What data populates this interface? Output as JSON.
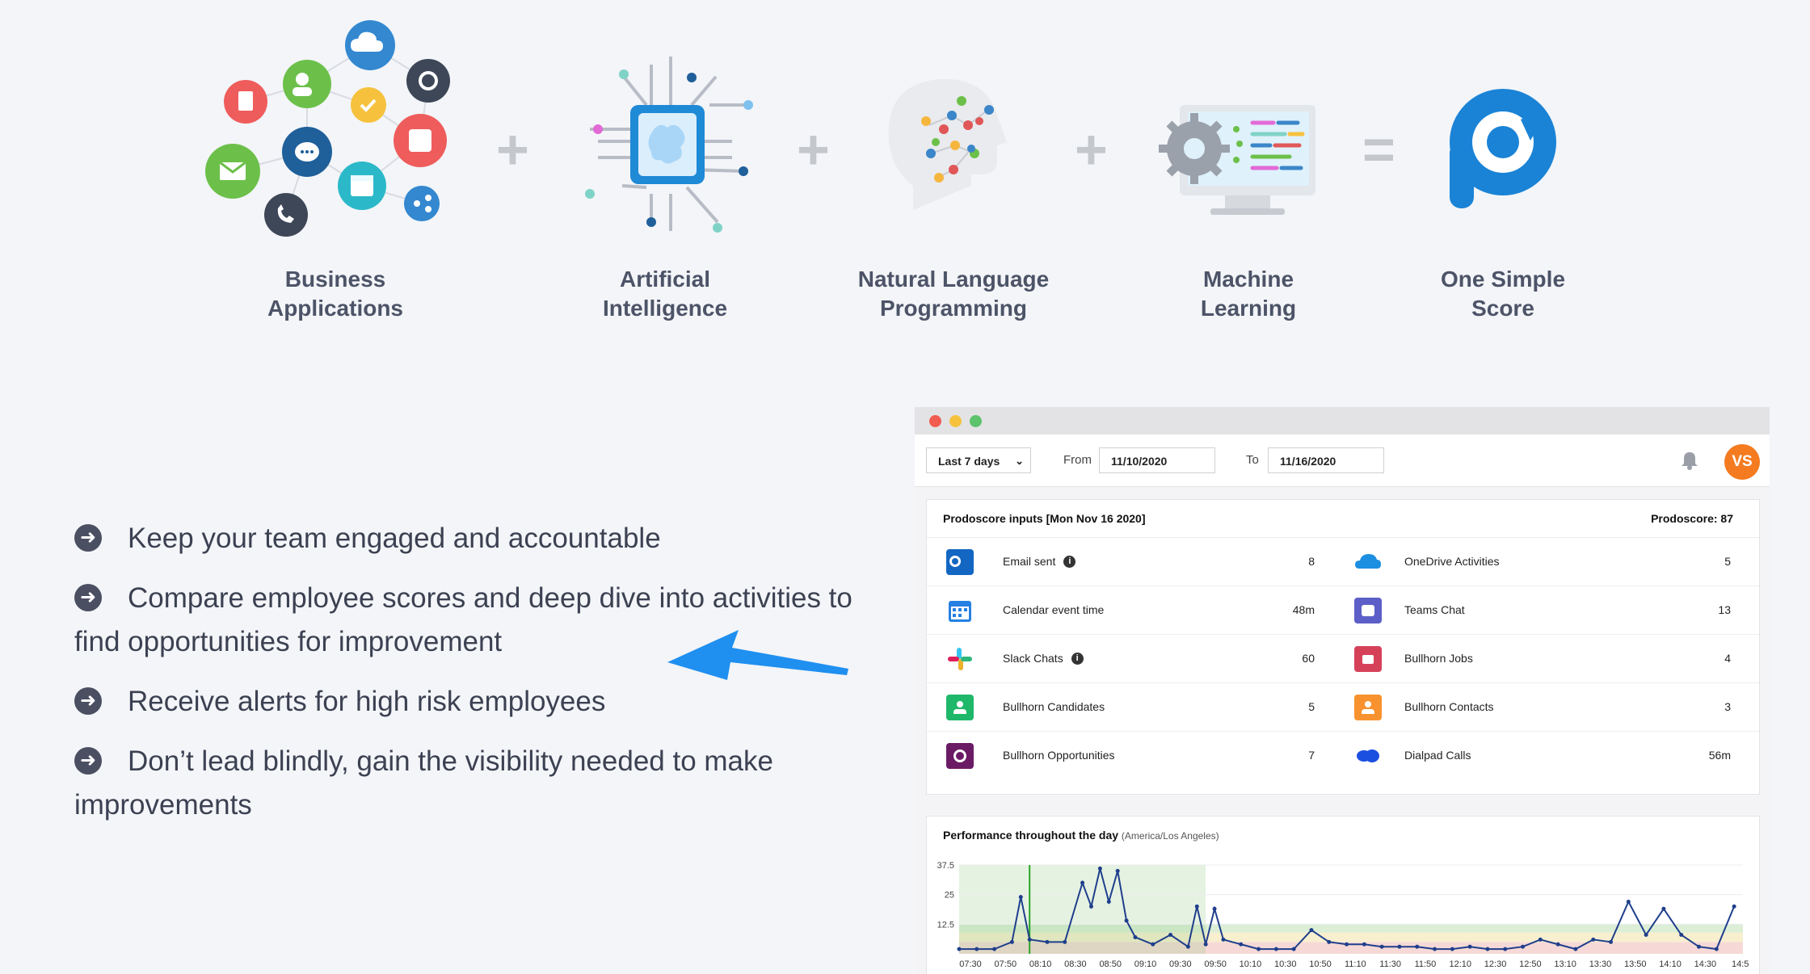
{
  "formula": {
    "items": [
      {
        "label": "Business\nApplications"
      },
      {
        "label": "Artificial\nIntelligence"
      },
      {
        "label": "Natural Language\nProgramming"
      },
      {
        "label": "Machine\nLearning"
      },
      {
        "label": "One Simple\nScore"
      }
    ],
    "operators": [
      "+",
      "+",
      "+",
      "="
    ]
  },
  "bullets": [
    "Keep your team engaged and accountable",
    "Compare employee scores and deep dive into activities to find opportunities for improvement",
    "Receive alerts for high risk employees",
    "Don’t lead blindly, gain the visibility needed to make improvements"
  ],
  "toolbar": {
    "range": "Last 7 days",
    "from_label": "From",
    "from_value": "11/10/2020",
    "to_label": "To",
    "to_value": "11/16/2020",
    "avatar": "VS"
  },
  "inputs": {
    "title": "Prodoscore inputs [Mon Nov 16 2020]",
    "score": "Prodoscore: 87",
    "rows": [
      {
        "left": {
          "name": "Email sent",
          "value": "8",
          "info": true
        },
        "right": {
          "name": "OneDrive Activities",
          "value": "5"
        }
      },
      {
        "left": {
          "name": "Calendar event time",
          "value": "48m"
        },
        "right": {
          "name": "Teams Chat",
          "value": "13"
        }
      },
      {
        "left": {
          "name": "Slack Chats",
          "value": "60",
          "info": true
        },
        "right": {
          "name": "Bullhorn Jobs",
          "value": "4"
        }
      },
      {
        "left": {
          "name": "Bullhorn Candidates",
          "value": "5"
        },
        "right": {
          "name": "Bullhorn Contacts",
          "value": "3"
        }
      },
      {
        "left": {
          "name": "Bullhorn Opportunities",
          "value": "7"
        },
        "right": {
          "name": "Dialpad Calls",
          "value": "56m"
        }
      }
    ]
  },
  "performance": {
    "title": "Performance throughout the day",
    "timezone": "(America/Los Angeles)"
  },
  "chart_data": {
    "type": "line",
    "title": "Performance throughout the day",
    "ylim": [
      0,
      37.5
    ],
    "yticks": [
      "37.5",
      "25",
      "12.5"
    ],
    "xticks": [
      "07:30",
      "07:50",
      "08:10",
      "08:30",
      "08:50",
      "09:10",
      "09:30",
      "09:50",
      "10:10",
      "10:30",
      "10:50",
      "11:10",
      "11:30",
      "11:50",
      "12:10",
      "12:30",
      "12:50",
      "13:10",
      "13:30",
      "13:50",
      "14:10",
      "14:30",
      "14:5"
    ],
    "x": [
      "07:30",
      "07:40",
      "07:50",
      "08:00",
      "08:05",
      "08:10",
      "08:20",
      "08:30",
      "08:40",
      "08:45",
      "08:50",
      "08:55",
      "09:00",
      "09:05",
      "09:10",
      "09:20",
      "09:30",
      "09:40",
      "09:45",
      "09:50",
      "09:55",
      "10:00",
      "10:10",
      "10:20",
      "10:30",
      "10:40",
      "10:50",
      "11:00",
      "11:10",
      "11:20",
      "11:30",
      "11:40",
      "11:50",
      "12:00",
      "12:10",
      "12:20",
      "12:30",
      "12:40",
      "12:50",
      "13:00",
      "13:10",
      "13:20",
      "13:30",
      "13:40",
      "13:50",
      "14:00",
      "14:10",
      "14:20",
      "14:30",
      "14:40",
      "14:50"
    ],
    "values": [
      2,
      2,
      2,
      5,
      24,
      6,
      5,
      5,
      30,
      20,
      36,
      22,
      35,
      14,
      7,
      4,
      8,
      3,
      20,
      4,
      19,
      6,
      4,
      2,
      2,
      2,
      10,
      5,
      4,
      4,
      3,
      3,
      3,
      2,
      2,
      3,
      2,
      2,
      3,
      6,
      4,
      2,
      6,
      5,
      22,
      8,
      19,
      8,
      3,
      2,
      20
    ]
  }
}
